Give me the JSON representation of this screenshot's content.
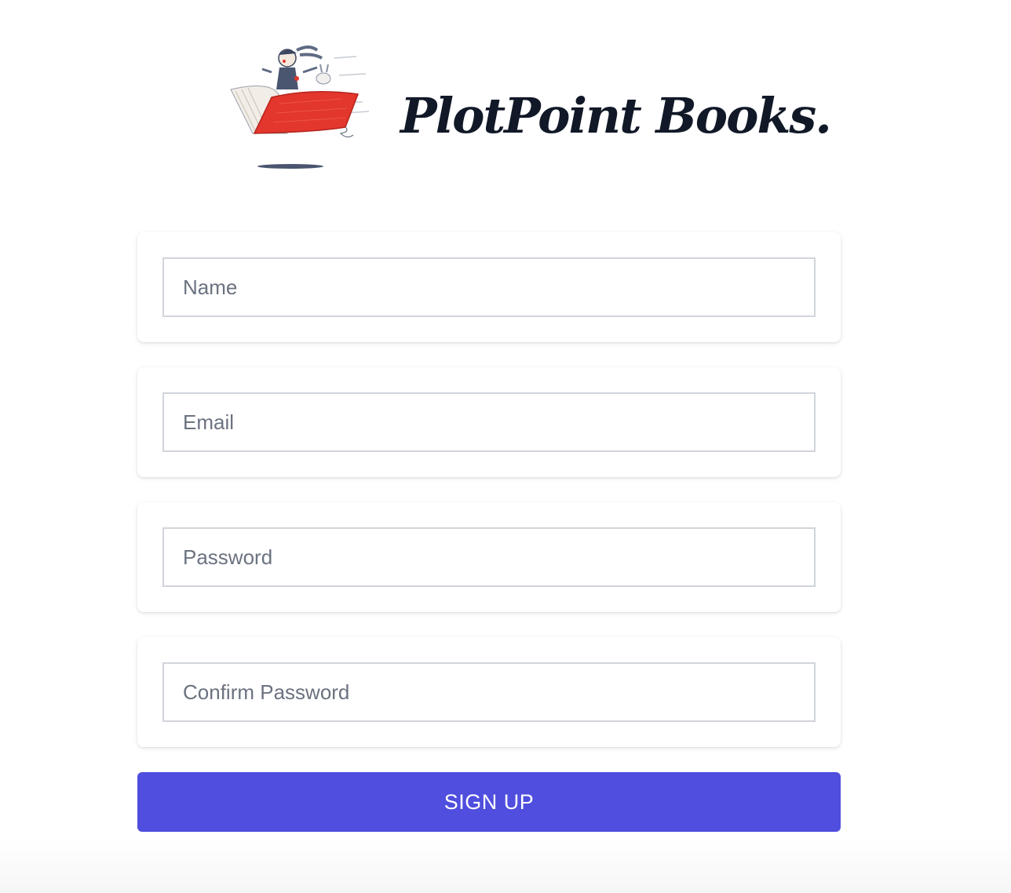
{
  "header": {
    "brand_name": "PlotPoint Books.",
    "logo_icon": "flying-book-illustration"
  },
  "form": {
    "fields": [
      {
        "placeholder": "Name",
        "value": ""
      },
      {
        "placeholder": "Email",
        "value": ""
      },
      {
        "placeholder": "Password",
        "value": ""
      },
      {
        "placeholder": "Confirm Password",
        "value": ""
      }
    ],
    "submit_label": "SIGN UP"
  },
  "colors": {
    "accent": "#4f4ede",
    "book_red": "#e3362d",
    "brand_text": "#111827",
    "input_border": "#d1d5db"
  }
}
